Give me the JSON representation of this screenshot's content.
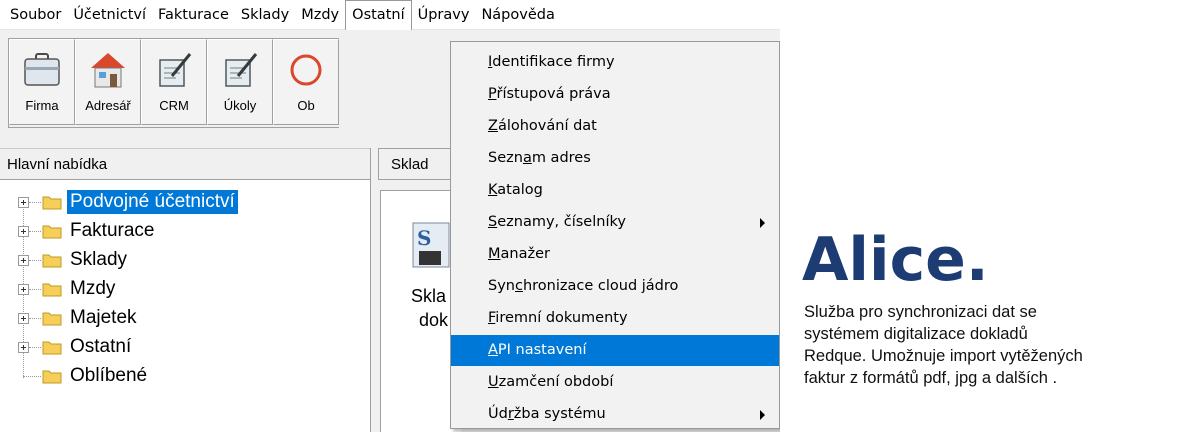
{
  "menubar": {
    "items": [
      "Soubor",
      "Účetnictví",
      "Fakturace",
      "Sklady",
      "Mzdy",
      "Ostatní",
      "Úpravy",
      "Nápověda"
    ],
    "active_index": 5
  },
  "toolbar": {
    "buttons": [
      {
        "label": "Firma",
        "icon": "briefcase-icon"
      },
      {
        "label": "Adresář",
        "icon": "house-icon"
      },
      {
        "label": "CRM",
        "icon": "notepad-icon"
      },
      {
        "label": "Úkoly",
        "icon": "notepad-icon"
      },
      {
        "label": "Ob",
        "icon": "clock-icon"
      }
    ]
  },
  "left_panel": {
    "header": "Hlavní nabídka",
    "tree": [
      {
        "label": "Podvojné účetnictví",
        "selected": true,
        "expandable": true
      },
      {
        "label": "Fakturace",
        "expandable": true
      },
      {
        "label": "Sklady",
        "expandable": true
      },
      {
        "label": "Mzdy",
        "expandable": true
      },
      {
        "label": "Majetek",
        "expandable": true
      },
      {
        "label": "Ostatní",
        "expandable": true
      },
      {
        "label": "Oblíbené",
        "expandable": false
      }
    ]
  },
  "content": {
    "tab_label": "Sklad",
    "text_line1": "Skla",
    "text_line2": "dok"
  },
  "dropdown": {
    "items": [
      {
        "label": "Identifikace firmy",
        "underline": "I"
      },
      {
        "label": "Přístupová práva",
        "underline": "P"
      },
      {
        "label": "Zálohování dat",
        "underline": "Z"
      },
      {
        "label": "Seznam adres",
        "underline": "a"
      },
      {
        "label": "Katalog",
        "underline": "K"
      },
      {
        "label": "Seznamy, číselníky",
        "underline": "S",
        "submenu": true
      },
      {
        "label": "Manažer",
        "underline": "M"
      },
      {
        "label": "Synchronizace cloud jádro",
        "underline": "c"
      },
      {
        "label": "Firemní dokumenty",
        "underline": "F"
      },
      {
        "label": "API nastavení",
        "underline": "A",
        "highlighted": true
      },
      {
        "label": "Uzamčení období",
        "underline": "U"
      },
      {
        "label": "Údržba systému",
        "underline": "r",
        "submenu": true
      }
    ]
  },
  "promo": {
    "logo_text": "Alice.",
    "line1": "Služba pro synchronizaci dat se",
    "line2": "systémem digitalizace dokladů",
    "line3": "Redque. Umožnuje import vytěžených",
    "line4": "faktur z formátů pdf, jpg a dalších .",
    "brand_color": "#1d3c73"
  },
  "colors": {
    "selection": "#0078d7",
    "menu_bg": "#f2f2f2"
  }
}
